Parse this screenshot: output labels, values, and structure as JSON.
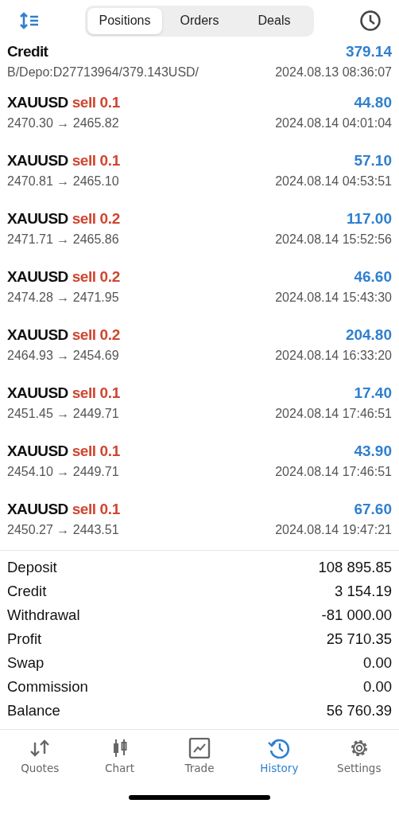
{
  "tabs": [
    {
      "label": "Positions",
      "selected": true
    },
    {
      "label": "Orders",
      "selected": false
    },
    {
      "label": "Deals",
      "selected": false
    }
  ],
  "deals": [
    {
      "kind": "balance",
      "title": "Credit",
      "amount": "379.14",
      "detail": "B/Depo:D27713964/379.143USD/",
      "time": "2024.08.13 08:36:07"
    },
    {
      "kind": "trade",
      "symbol": "XAUUSD",
      "side": "sell",
      "volume": "0.1",
      "prices": "2470.30 → 2465.82",
      "profit": "44.80",
      "time": "2024.08.14 04:01:04"
    },
    {
      "kind": "trade",
      "symbol": "XAUUSD",
      "side": "sell",
      "volume": "0.1",
      "prices": "2470.81 → 2465.10",
      "profit": "57.10",
      "time": "2024.08.14 04:53:51"
    },
    {
      "kind": "trade",
      "symbol": "XAUUSD",
      "side": "sell",
      "volume": "0.2",
      "prices": "2471.71 → 2465.86",
      "profit": "117.00",
      "time": "2024.08.14 15:52:56"
    },
    {
      "kind": "trade",
      "symbol": "XAUUSD",
      "side": "sell",
      "volume": "0.2",
      "prices": "2474.28 → 2471.95",
      "profit": "46.60",
      "time": "2024.08.14 15:43:30"
    },
    {
      "kind": "trade",
      "symbol": "XAUUSD",
      "side": "sell",
      "volume": "0.2",
      "prices": "2464.93 → 2454.69",
      "profit": "204.80",
      "time": "2024.08.14 16:33:20"
    },
    {
      "kind": "trade",
      "symbol": "XAUUSD",
      "side": "sell",
      "volume": "0.1",
      "prices": "2451.45 → 2449.71",
      "profit": "17.40",
      "time": "2024.08.14 17:46:51"
    },
    {
      "kind": "trade",
      "symbol": "XAUUSD",
      "side": "sell",
      "volume": "0.1",
      "prices": "2454.10 → 2449.71",
      "profit": "43.90",
      "time": "2024.08.14 17:46:51"
    },
    {
      "kind": "trade",
      "symbol": "XAUUSD",
      "side": "sell",
      "volume": "0.1",
      "prices": "2450.27 → 2443.51",
      "profit": "67.60",
      "time": "2024.08.14 19:47:21"
    }
  ],
  "summary": [
    {
      "label": "Deposit",
      "value": "108 895.85"
    },
    {
      "label": "Credit",
      "value": "3 154.19"
    },
    {
      "label": "Withdrawal",
      "value": "-81 000.00"
    },
    {
      "label": "Profit",
      "value": "25 710.35"
    },
    {
      "label": "Swap",
      "value": "0.00"
    },
    {
      "label": "Commission",
      "value": "0.00"
    },
    {
      "label": "Balance",
      "value": "56 760.39"
    }
  ],
  "nav": [
    {
      "kind": "quotes",
      "label": "Quotes",
      "selected": false
    },
    {
      "kind": "chart",
      "label": "Chart",
      "selected": false
    },
    {
      "kind": "trade",
      "label": "Trade",
      "selected": false
    },
    {
      "kind": "history",
      "label": "History",
      "selected": true
    },
    {
      "kind": "settings",
      "label": "Settings",
      "selected": false
    }
  ]
}
